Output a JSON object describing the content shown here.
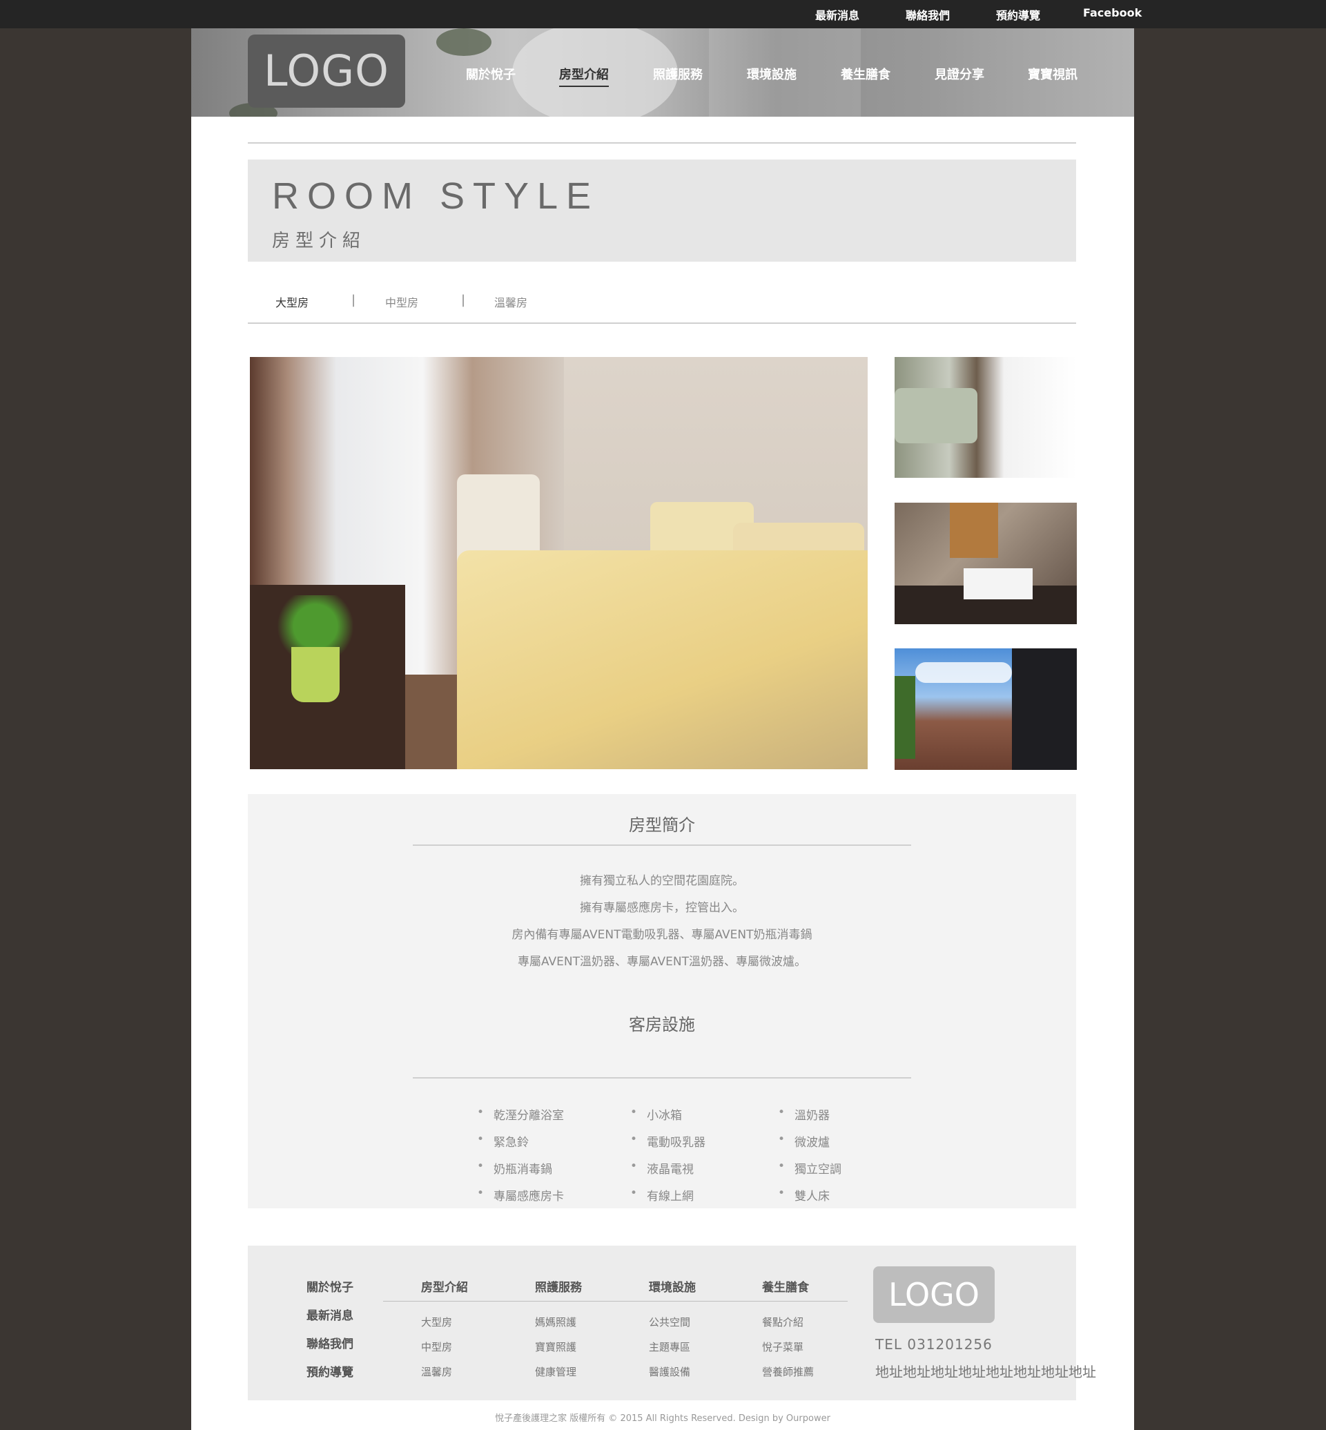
{
  "topbar": {
    "links": [
      "最新消息",
      "聯絡我們",
      "預約導覽",
      "Facebook"
    ]
  },
  "header": {
    "logo": "LOGO",
    "nav": [
      "關於悅子",
      "房型介紹",
      "照護服務",
      "環境設施",
      "養生膳食",
      "見證分享",
      "寶寶視訊"
    ],
    "active_nav": "房型介紹"
  },
  "title": {
    "en": "ROOM STYLE",
    "zh": "房型介紹"
  },
  "tabs": {
    "items": [
      "大型房",
      "中型房",
      "溫馨房"
    ],
    "separator": "|",
    "active": "大型房"
  },
  "intro": {
    "title": "房型簡介",
    "lines": [
      "擁有獨立私人的空間花園庭院。",
      "擁有專屬感應房卡，控管出入。",
      "房內備有專屬AVENT電動吸乳器、專屬AVENT奶瓶消毒鍋",
      "專屬AVENT溫奶器、專屬AVENT溫奶器、專屬微波爐。"
    ]
  },
  "facilities": {
    "title": "客房設施",
    "columns": [
      [
        "乾溼分離浴室",
        "緊急鈴",
        "奶瓶消毒鍋",
        "專屬感應房卡"
      ],
      [
        "小冰箱",
        "電動吸乳器",
        "液晶電視",
        "有線上網"
      ],
      [
        "溫奶器",
        "微波爐",
        "獨立空調",
        "雙人床"
      ]
    ]
  },
  "footer": {
    "main_links": [
      "關於悅子",
      "最新消息",
      "聯絡我們",
      "預約導覽"
    ],
    "groups": [
      {
        "title": "房型介紹",
        "items": [
          "大型房",
          "中型房",
          "溫馨房"
        ]
      },
      {
        "title": "照護服務",
        "items": [
          "媽媽照護",
          "寶寶照護",
          "健康管理"
        ]
      },
      {
        "title": "環境設施",
        "items": [
          "公共空間",
          "主題專區",
          "醫護設備"
        ]
      },
      {
        "title": "養生膳食",
        "items": [
          "餐點介紹",
          "悅子菜單",
          "營養師推薦"
        ]
      }
    ],
    "logo": "LOGO",
    "tel": "TEL  031201256",
    "address": "地址地址地址地址地址地址地址地址",
    "copyright": "悅子產後護理之家 版權所有 © 2015  All Rights Reserved. Design by Ourpower"
  }
}
